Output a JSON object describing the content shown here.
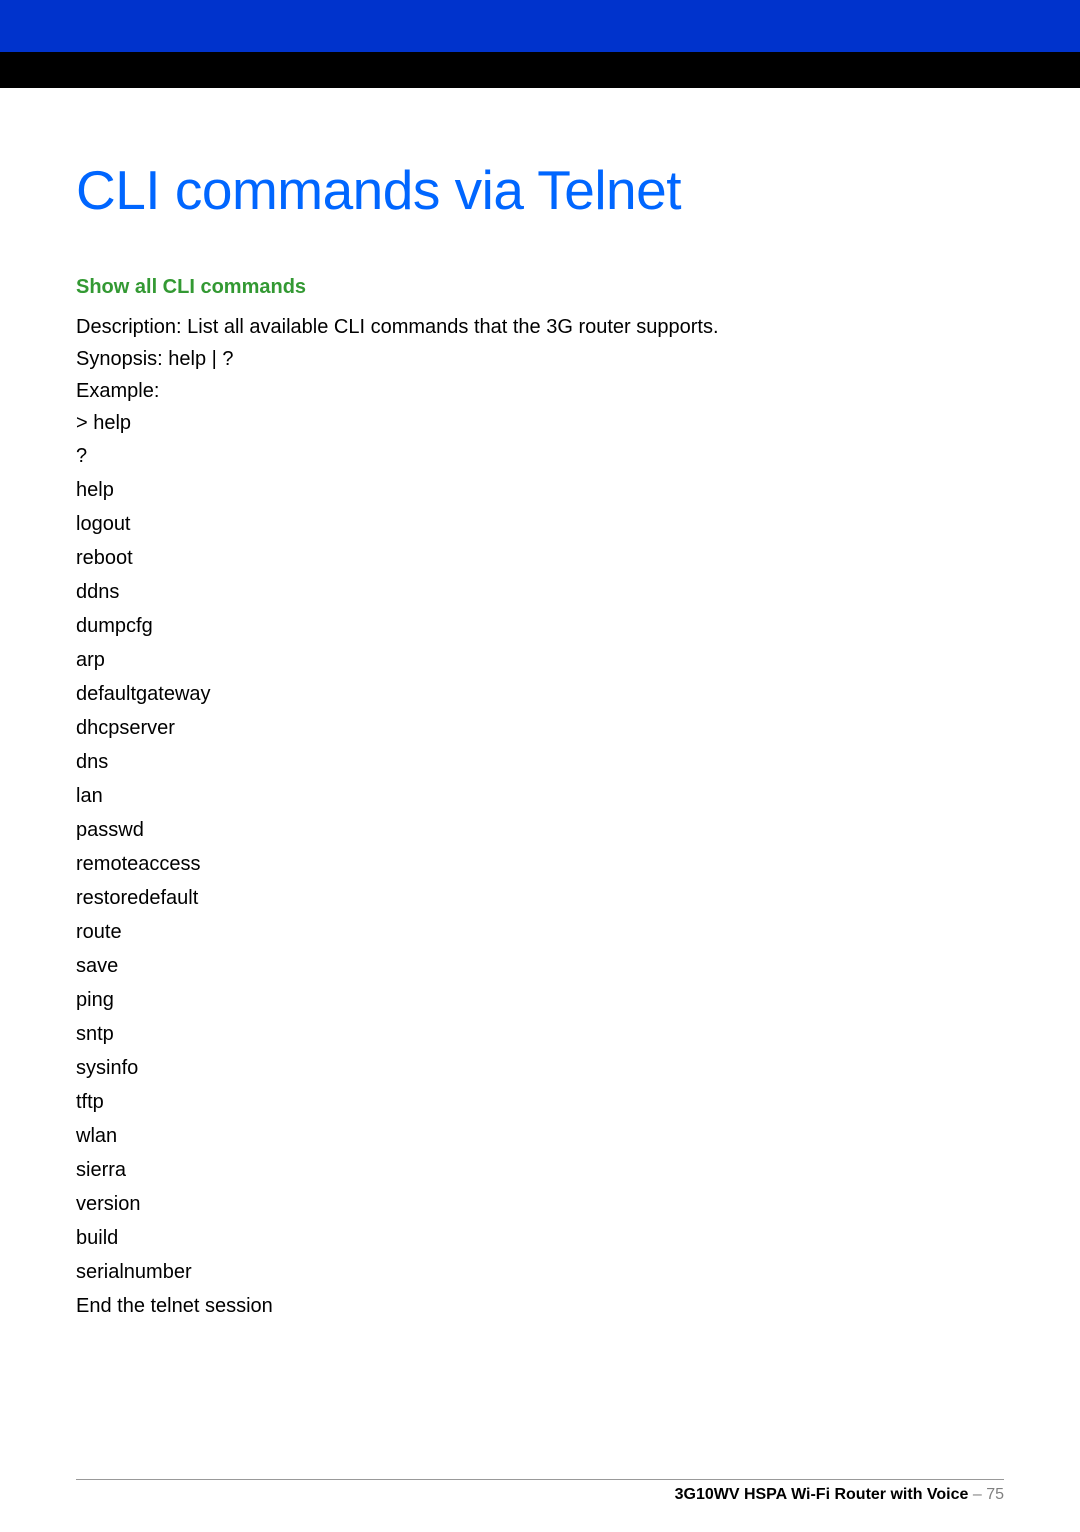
{
  "title": "CLI commands via Telnet",
  "section": {
    "heading": "Show all CLI commands",
    "description": "Description: List all available CLI commands that the 3G router supports.",
    "synopsis": "Synopsis: help | ?",
    "exampleLabel": "Example:",
    "prompt": "> help",
    "commands": [
      "?",
      "help",
      "logout",
      "reboot",
      "ddns",
      "dumpcfg",
      "arp",
      "defaultgateway",
      "dhcpserver",
      "dns",
      "lan",
      "passwd",
      "remoteaccess",
      "restoredefault",
      "route",
      "save",
      "ping",
      "sntp",
      "sysinfo",
      "tftp",
      "wlan",
      "sierra",
      "version",
      "build",
      "serialnumber",
      "End the telnet session"
    ]
  },
  "footer": {
    "product": "3G10WV HSPA Wi-Fi Router with Voice",
    "separator": " – ",
    "page": "75"
  }
}
